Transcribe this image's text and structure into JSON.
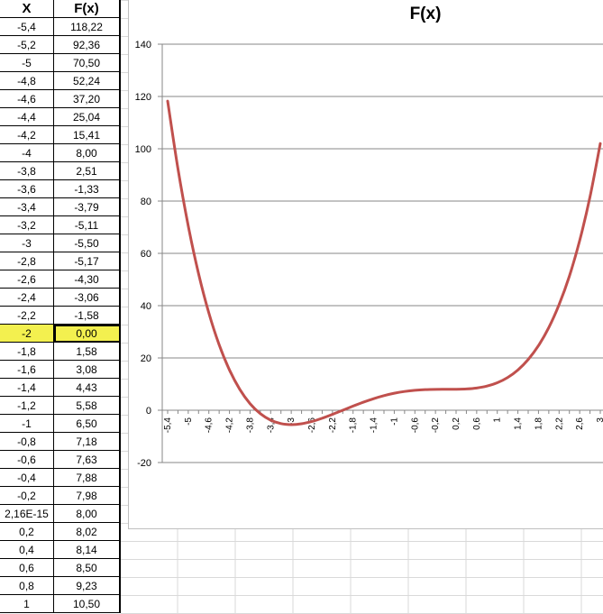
{
  "table": {
    "header": {
      "x": "X",
      "f": "F(x)"
    },
    "rows": [
      {
        "x": "-5,4",
        "f": "118,22"
      },
      {
        "x": "-5,2",
        "f": "92,36"
      },
      {
        "x": "-5",
        "f": "70,50"
      },
      {
        "x": "-4,8",
        "f": "52,24"
      },
      {
        "x": "-4,6",
        "f": "37,20"
      },
      {
        "x": "-4,4",
        "f": "25,04"
      },
      {
        "x": "-4,2",
        "f": "15,41"
      },
      {
        "x": "-4",
        "f": "8,00"
      },
      {
        "x": "-3,8",
        "f": "2,51"
      },
      {
        "x": "-3,6",
        "f": "-1,33"
      },
      {
        "x": "-3,4",
        "f": "-3,79"
      },
      {
        "x": "-3,2",
        "f": "-5,11"
      },
      {
        "x": "-3",
        "f": "-5,50"
      },
      {
        "x": "-2,8",
        "f": "-5,17"
      },
      {
        "x": "-2,6",
        "f": "-4,30"
      },
      {
        "x": "-2,4",
        "f": "-3,06"
      },
      {
        "x": "-2,2",
        "f": "-1,58"
      },
      {
        "x": "-2",
        "f": "0,00"
      },
      {
        "x": "-1,8",
        "f": "1,58"
      },
      {
        "x": "-1,6",
        "f": "3,08"
      },
      {
        "x": "-1,4",
        "f": "4,43"
      },
      {
        "x": "-1,2",
        "f": "5,58"
      },
      {
        "x": "-1",
        "f": "6,50"
      },
      {
        "x": "-0,8",
        "f": "7,18"
      },
      {
        "x": "-0,6",
        "f": "7,63"
      },
      {
        "x": "-0,4",
        "f": "7,88"
      },
      {
        "x": "-0,2",
        "f": "7,98"
      },
      {
        "x": "2,16E-15",
        "f": "8,00"
      },
      {
        "x": "0,2",
        "f": "8,02"
      },
      {
        "x": "0,4",
        "f": "8,14"
      },
      {
        "x": "0,6",
        "f": "8,50"
      },
      {
        "x": "0,8",
        "f": "9,23"
      },
      {
        "x": "1",
        "f": "10,50"
      }
    ],
    "selected_row": 17,
    "selected_color": "#f3f04f"
  },
  "chart_data": {
    "type": "line",
    "title": "F(x)",
    "series": [
      {
        "color": "#c0504d",
        "x": [
          -5.4,
          -5.2,
          -5,
          -4.8,
          -4.6,
          -4.4,
          -4.2,
          -4,
          -3.8,
          -3.6,
          -3.4,
          -3.2,
          -3,
          -2.8,
          -2.6,
          -2.4,
          -2.2,
          -2,
          -1.8,
          -1.6,
          -1.4,
          -1.2,
          -1,
          -0.8,
          -0.6,
          -0.4,
          -0.2,
          0,
          0.2,
          0.4,
          0.6,
          0.8,
          1,
          1.2,
          1.4,
          1.6,
          1.8,
          2,
          2.2,
          2.4,
          2.6,
          2.8,
          3
        ],
        "y": [
          118.22,
          92.36,
          70.5,
          52.24,
          37.2,
          25.04,
          15.41,
          8,
          2.51,
          -1.33,
          -3.79,
          -5.11,
          -5.5,
          -5.17,
          -4.3,
          -3.06,
          -1.58,
          0,
          1.58,
          3.08,
          4.43,
          5.58,
          6.5,
          7.18,
          7.63,
          7.88,
          7.98,
          8,
          8.02,
          8.14,
          8.5,
          9.23,
          10.5,
          12.5,
          15.4,
          19.4,
          24.7,
          31.6,
          40.4,
          51.3,
          64.9,
          81.6,
          102
        ]
      }
    ],
    "categories": [
      "-5,4",
      "-5,2",
      "-5",
      "-4,8",
      "-4,6",
      "-4,4",
      "-4,2",
      "-4",
      "-3,8",
      "-3,6",
      "-3,4",
      "-3,2",
      "-3",
      "-2,8",
      "-2,6",
      "-2,4",
      "-2,2",
      "-2",
      "-1,8",
      "-1,6",
      "-1,4",
      "-1,2",
      "-1",
      "-0,8",
      "-0,6",
      "-0,4",
      "-0,2",
      "2,16E-15",
      "0,2",
      "0,4",
      "0,6",
      "0,8",
      "1",
      "1,2",
      "1,4",
      "1,6",
      "1,8",
      "2",
      "2,2",
      "2,4",
      "2,6",
      "2,8",
      "3"
    ],
    "x_tick_labels": [
      "-5,4",
      "-5",
      "-4,6",
      "-4,2",
      "-3,8",
      "-3,4",
      "-3",
      "-2,6",
      "-2,2",
      "-1,8",
      "-1,4",
      "-1",
      "-0,6",
      "-0,2",
      "0,2",
      "0,6",
      "1",
      "1,4",
      "1,8",
      "2,2",
      "2,6",
      "3"
    ],
    "y_ticks": [
      -20,
      0,
      20,
      40,
      60,
      80,
      100,
      120,
      140
    ],
    "y_tick_labels": [
      "-20",
      "0",
      "20",
      "40",
      "60",
      "80",
      "100",
      "120",
      "140"
    ],
    "ylim": [
      -20,
      140
    ],
    "grid": true,
    "legend": "none"
  }
}
